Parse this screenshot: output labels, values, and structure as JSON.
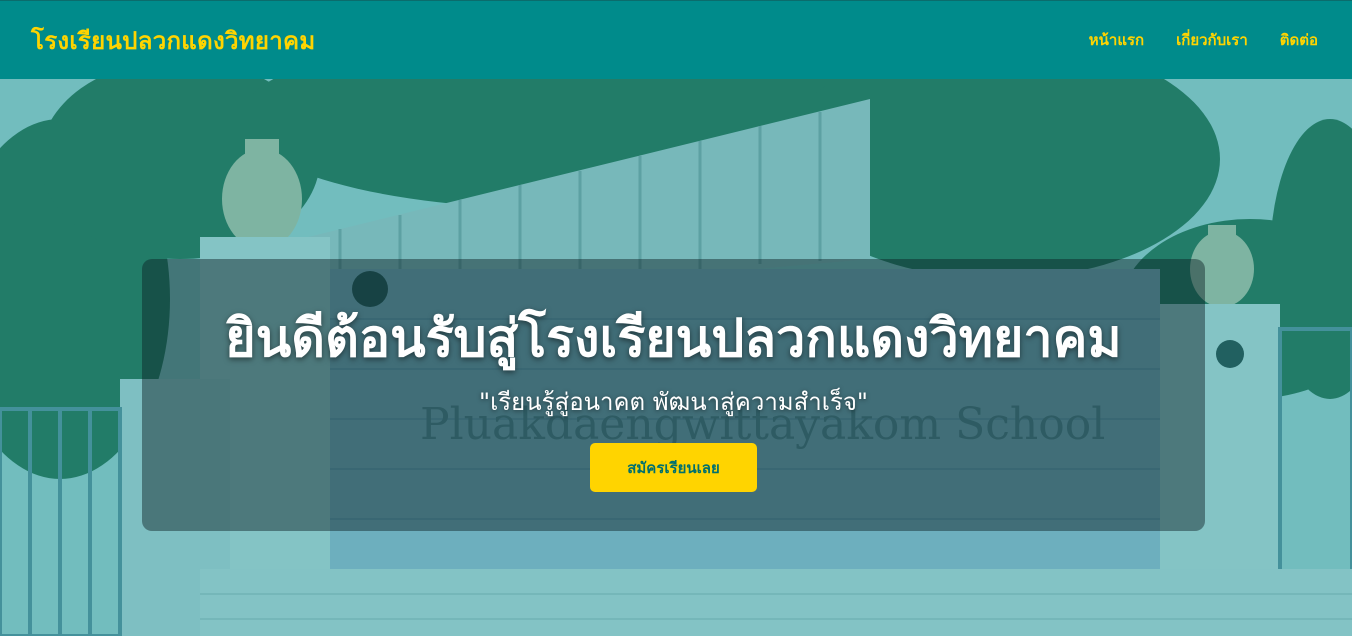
{
  "header": {
    "brand": "โรงเรียนปลวกแดงวิทยาคม",
    "nav": [
      "หน้าแรก",
      "เกี่ยวกับเรา",
      "ติดต่อ"
    ]
  },
  "hero": {
    "title": "ยินดีต้อนรับสู่โรงเรียนปลวกแดงวิทยาคม",
    "subtitle": "\"เรียนรู้สู่อนาคต พัฒนาสู่ความสำเร็จ\"",
    "cta": "สมัครเรียนเลย",
    "background_sign_text": "Pluakdaengwittayakom School"
  },
  "colors": {
    "header_bg": "#008b8b",
    "accent": "#ffd400",
    "hero_tint": "#008b8b"
  }
}
